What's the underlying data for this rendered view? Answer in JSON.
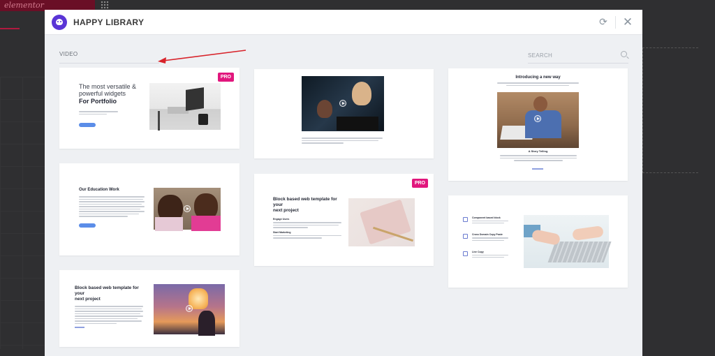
{
  "background_editor": {
    "logo_text": "elementor"
  },
  "modal": {
    "title": "HAPPY LIBRARY",
    "sync_icon": "sync-icon",
    "close_icon": "close-icon",
    "filter": {
      "value": "VIDEO"
    },
    "search": {
      "placeholder": "SEARCH",
      "value": ""
    }
  },
  "colors": {
    "brand": "#5a35d6",
    "pro_badge": "#e1177d",
    "accent_button": "#5b8de8"
  },
  "cards": [
    {
      "id": "portfolio",
      "pro": "PRO",
      "heading_line1": "The most versatile &",
      "heading_line2": "powerful widgets",
      "heading_line3": "For Portfolio"
    },
    {
      "id": "video-girls",
      "pro": ""
    },
    {
      "id": "intro",
      "heading": "Introducing a new way",
      "sub_heading": "A Story Telling"
    },
    {
      "id": "education",
      "heading": "Our Education Work"
    },
    {
      "id": "block-pro",
      "pro": "PRO",
      "heading_line1": "Block based web template for your",
      "heading_line2": "next project",
      "sub1": "Engage Users",
      "sub2": "Start Marketing"
    },
    {
      "id": "features",
      "f1": "Component based block",
      "f2": "Cross Domain Copy Paste",
      "f3": "Live Copy"
    },
    {
      "id": "block-lantern",
      "heading_line1": "Block based web template for your",
      "heading_line2": "next project"
    }
  ]
}
